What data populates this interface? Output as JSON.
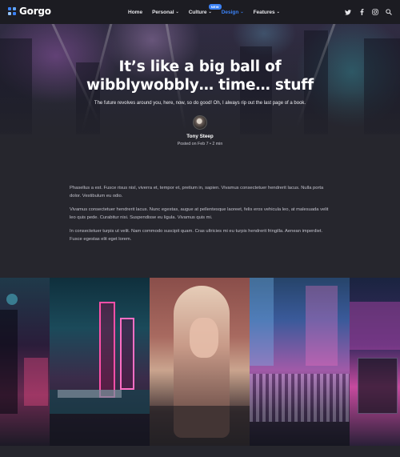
{
  "brand": {
    "name": "Gorgo",
    "logo_colors": [
      "#3b82f6",
      "#60a5fa",
      "#93c5fd",
      "#3b82f6"
    ]
  },
  "nav": {
    "items": [
      {
        "label": "Home",
        "has_caret": false,
        "active": false
      },
      {
        "label": "Personal",
        "has_caret": true,
        "active": false
      },
      {
        "label": "Culture",
        "has_caret": true,
        "active": false,
        "badge": "NEW"
      },
      {
        "label": "Design",
        "has_caret": true,
        "active": true
      },
      {
        "label": "Features",
        "has_caret": true,
        "active": false
      }
    ],
    "active_color": "#3b82f6"
  },
  "social_icons": [
    "twitter-icon",
    "facebook-icon",
    "instagram-icon",
    "search-icon"
  ],
  "post": {
    "title_line1": "It’s like a big ball of",
    "title_line2": "wibblywobbly… time… stuff",
    "subtitle": "The future revolves around you, here, now, so do good! Oh, I always rip out the last page of a book.",
    "author": "Tony Steep",
    "meta": "Posted on Feb 7  •  2 min",
    "paragraphs": [
      "Phasellus a est. Fusce risus nisl, viverra et, tempor et, pretium in, sapien. Vivamus consectetuer hendrerit lacus. Nulla porta dolor. Vestibulum eu odio.",
      "Vivamus consectetuer hendrerit lacus. Nunc egestas, augue at pellentesque laoreet, felis eros vehicula leo, at malesuada velit leo quis pede. Curabitur nisi. Suspendisse eu ligula. Vivamus quis mi.",
      "In consectetuer turpis ut velit. Nam commodo suscipit quam. Cras ultricies mi eu turpis hendrerit fringilla. Aenean imperdiet. Fusce egestas elit eget lorem."
    ]
  },
  "gallery": {
    "images": [
      "neon-alley-photo",
      "neon-signs-street-photo",
      "portrait-woman-photo",
      "crowd-crossing-photo",
      "neon-tram-street-photo"
    ]
  }
}
